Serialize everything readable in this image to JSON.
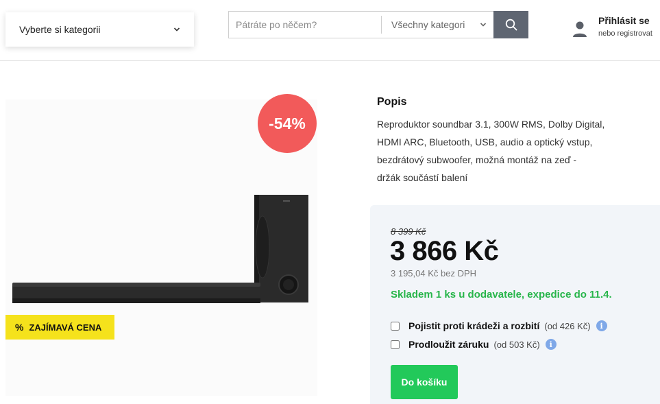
{
  "header": {
    "category_select": {
      "label": "Vyberte si kategorii",
      "icon": "chevron-down-icon"
    },
    "search": {
      "placeholder": "Pátráte po něčem?",
      "category_label": "Všechny kategori",
      "icon": "search-icon"
    },
    "account": {
      "title": "Přihlásit se",
      "subtitle": "nebo registrovat",
      "icon": "user-icon"
    }
  },
  "product": {
    "discount_badge": "-54%",
    "promo_badge": {
      "icon": "%",
      "label": "ZAJÍMAVÁ CENA"
    },
    "description": {
      "title": "Popis",
      "lines": [
        "Reproduktor soundbar 3.1, 300W RMS, Dolby Digital,",
        "HDMI ARC, Bluetooth, USB, audio a optický vstup,",
        "bezdrátový subwoofer, možná montáž na zeď -",
        "držák součástí balení"
      ]
    },
    "pricing": {
      "old_price": "8 399 Kč",
      "price": "3 866 Kč",
      "price_without_vat": "3 195,04 Kč bez DPH",
      "stock": "Skladem 1 ks u dodavatele, expedice do 11.4."
    },
    "options": [
      {
        "label": "Pojistit proti krádeži a rozbití",
        "extra": "(od 426 Kč)",
        "checked": false
      },
      {
        "label": "Prodloužit záruku",
        "extra": "(od 503 Kč)",
        "checked": false
      }
    ],
    "add_to_cart": "Do košíku"
  },
  "colors": {
    "discount": "#f25a5a",
    "promo": "#f5e21c",
    "stock": "#27b54a",
    "cart_button": "#22c95a",
    "search_button": "#5f6672",
    "info_icon": "#7fa8e8"
  }
}
